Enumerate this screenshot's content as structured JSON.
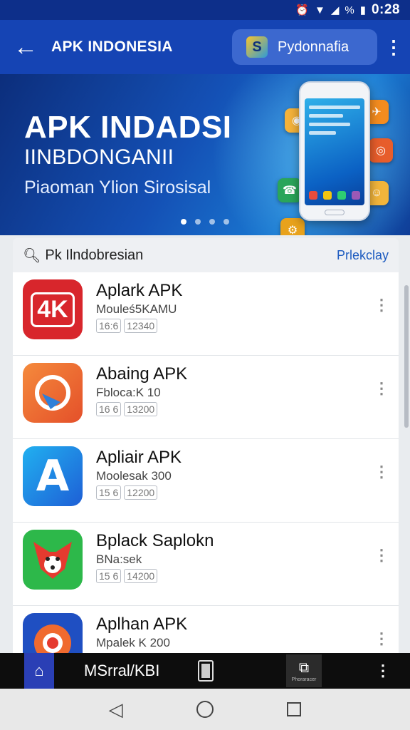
{
  "status_bar": {
    "time": "0:28",
    "percent": "%",
    "icons": [
      "alarm-icon",
      "wifi-icon",
      "signal-icon",
      "battery-icon"
    ]
  },
  "app_bar": {
    "title": "APK INDONESIA",
    "language_pill": "Pydonnafia",
    "back_icon": "arrow-left-icon",
    "menu_icon": "more-vert-icon"
  },
  "banner": {
    "headline": "APK INDADSI",
    "subhead": "IINBDONGANII",
    "tagline": "Piaoman Ylion Sirosisal",
    "slide_count": 4,
    "active_slide": 1
  },
  "search": {
    "query": "Pk Ilndobresian",
    "action": "Prlekclay"
  },
  "apps": [
    {
      "name": "Aplark APK",
      "developer": "Mouleś5KAMU",
      "badge": "16:6",
      "size": "12340",
      "icon": "4k-icon",
      "color": "#d8262c"
    },
    {
      "name": "Abaing APK",
      "developer": "Fbloca:K 10",
      "badge": "16 6",
      "size": "13200",
      "icon": "refresh-play-icon",
      "color": "#ef6b2e"
    },
    {
      "name": "Apliair APK",
      "developer": "Moolesak 300",
      "badge": "15 6",
      "size": "12200",
      "icon": "letter-a-icon",
      "color": "#1d7de0"
    },
    {
      "name": "Bplack Saplokn",
      "developer": "BNa:sek",
      "badge": "15 6",
      "size": "14200",
      "icon": "fox-icon",
      "color": "#2db84a"
    },
    {
      "name": "Aplhan APK",
      "developer": "Mpalek K 200",
      "badge": "",
      "size": "",
      "icon": "flower-icon",
      "color": "#1f4fc2"
    }
  ],
  "bottom_bar": {
    "label": "MSrral/KBI",
    "share_caption": "Phoraracer"
  },
  "colors": {
    "primary": "#1544b4",
    "status": "#0d2f8a",
    "link": "#1d5bc0"
  }
}
